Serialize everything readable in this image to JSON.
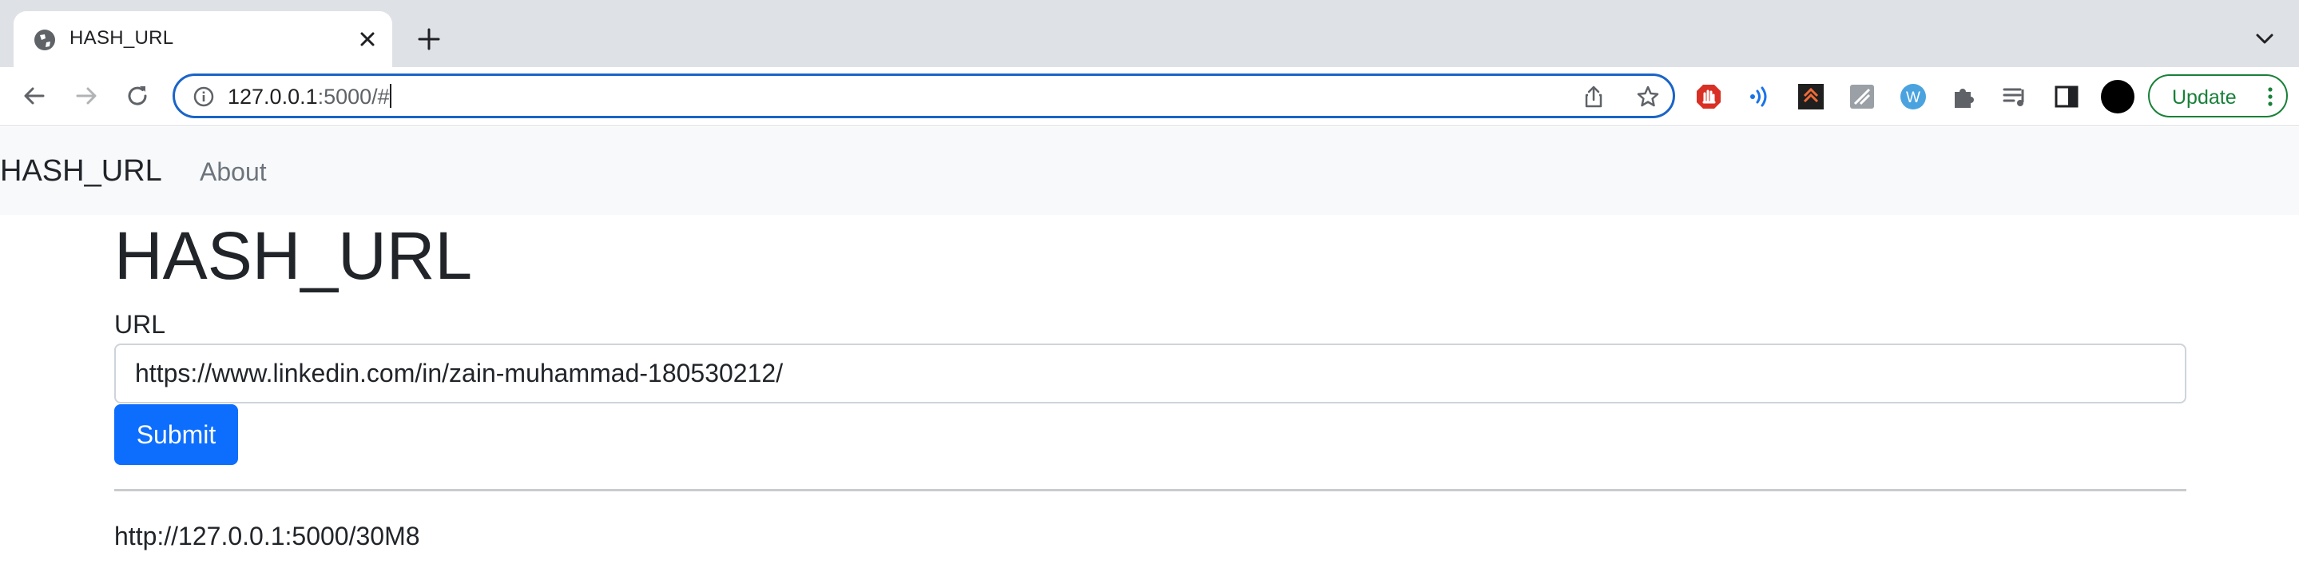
{
  "browser": {
    "tab": {
      "title": "HASH_URL"
    },
    "address_bar": {
      "host": "127.0.0.1",
      "rest": ":5000/#"
    },
    "update_button": {
      "label": "Update"
    },
    "extensions": [
      "ad-blocker-icon",
      "audio-extension-icon",
      "dark-extension-icon",
      "gray-extension-icon",
      "w-extension-icon",
      "puzzle-icon",
      "reading-list-icon",
      "side-panel-icon"
    ]
  },
  "navbar": {
    "brand": "HASH_URL",
    "links": [
      {
        "label": "About"
      }
    ]
  },
  "main": {
    "title": "HASH_URL",
    "form": {
      "url_label": "URL",
      "url_value": "https://www.linkedin.com/in/zain-muhammad-180530212/",
      "submit_label": "Submit"
    },
    "result_url": "http://127.0.0.1:5000/30M8"
  },
  "colors": {
    "primary_button": "#0d6efd",
    "omnibox_focus": "#1a64c8",
    "update_green": "#188038",
    "navbar_bg": "#f8f9fa"
  }
}
